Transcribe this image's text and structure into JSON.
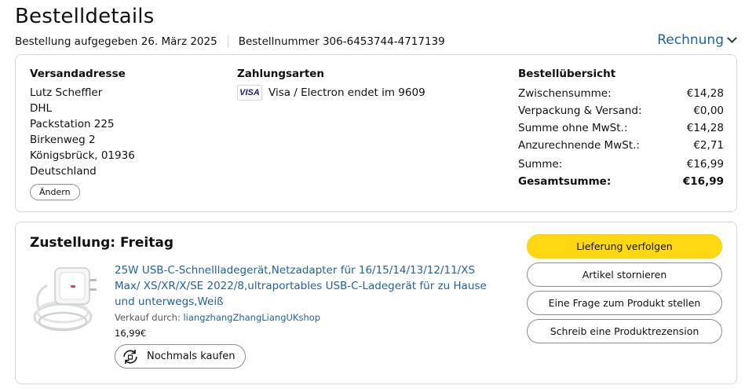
{
  "page": {
    "title": "Bestelldetails"
  },
  "meta": {
    "ordered_label": "Bestellung aufgegeben 26. März 2025",
    "order_number_label": "Bestellnummer 306-6453744-4717139",
    "invoice_label": "Rechnung"
  },
  "address": {
    "heading": "Versandadresse",
    "lines": [
      "Lutz Scheffler",
      "DHL",
      "Packstation 225",
      "Birkenweg 2",
      "Königsbrück, 01936",
      "Deutschland"
    ],
    "change_label": "Ändern"
  },
  "payment": {
    "heading": "Zahlungsarten",
    "card_logo": "VISA",
    "card_text": "Visa / Electron endet im 9609"
  },
  "summary": {
    "heading": "Bestellübersicht",
    "rows": [
      {
        "label": "Zwischensumme:",
        "value": "€14,28"
      },
      {
        "label": "Verpackung & Versand:",
        "value": "€0,00"
      },
      {
        "label": "Summe ohne MwSt.:",
        "value": "€14,28"
      },
      {
        "label": "Anzurechnende MwSt.:",
        "value": "€2,71"
      },
      {
        "label": "Summe:",
        "value": "€16,99"
      },
      {
        "label": "Gesamtsumme:",
        "value": "€16,99"
      }
    ]
  },
  "delivery": {
    "title": "Zustellung: Freitag",
    "product_title": "25W USB-C-Schnellladegerät,Netzadapter für 16/15/14/13/12/11/XS Max/ XS/XR/X/SE 2022/8,ultraportables USB-C-Ladegerät für zu Hause und unterwegs,Weiß",
    "seller_label": "Verkauf durch:",
    "seller_name": "liangzhangZhangLiangUKshop",
    "price": "16,99€",
    "buy_again_label": "Nochmals kaufen"
  },
  "actions": {
    "track": "Lieferung verfolgen",
    "cancel": "Artikel stornieren",
    "question": "Eine Frage zum Produkt stellen",
    "review": "Schreib eine Produktrezension"
  },
  "colors": {
    "link": "#2162a1",
    "primary_button": "#ffd814",
    "border": "#d5d9d9"
  },
  "icons": {
    "invoice": "chevron-down-icon",
    "buy_again": "reorder-cycle-icon",
    "card": "visa-logo"
  }
}
